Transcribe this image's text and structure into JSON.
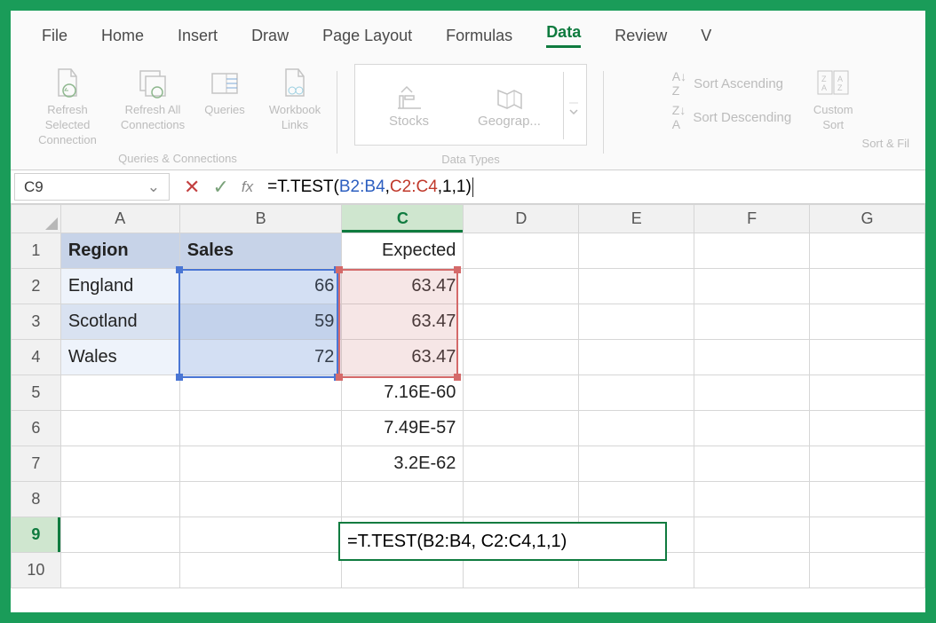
{
  "tabs": [
    "File",
    "Home",
    "Insert",
    "Draw",
    "Page Layout",
    "Formulas",
    "Data",
    "Review",
    "V"
  ],
  "activeTab": "Data",
  "ribbon": {
    "queries": {
      "refreshSelected": "Refresh Selected Connection",
      "refreshAll": "Refresh All Connections",
      "queries": "Queries",
      "workbookLinks": "Workbook Links",
      "groupLabel": "Queries & Connections"
    },
    "dataTypes": {
      "stocks": "Stocks",
      "geograp": "Geograp...",
      "groupLabel": "Data Types"
    },
    "sort": {
      "asc": "Sort Ascending",
      "desc": "Sort Descending",
      "custom": "Custom Sort",
      "groupLabel": "Sort & Fil"
    }
  },
  "nameBox": "C9",
  "formula": {
    "prefix": "=T.TEST(",
    "refB": "B2:B4",
    "comma1": ", ",
    "refC": "C2:C4",
    "suffix": ",1,1)"
  },
  "columns": [
    "A",
    "B",
    "C",
    "D",
    "E",
    "F",
    "G"
  ],
  "rows": [
    "1",
    "2",
    "3",
    "4",
    "5",
    "6",
    "7",
    "8",
    "9",
    "10"
  ],
  "cells": {
    "A1": "Region",
    "B1": "Sales",
    "C1": "Expected",
    "A2": "England",
    "B2": "66",
    "C2": "63.47",
    "A3": "Scotland",
    "B3": "59",
    "C3": "63.47",
    "A4": "Wales",
    "B4": "72",
    "C4": "63.47",
    "C5": "7.16E-60",
    "C6": "7.49E-57",
    "C7": "3.2E-62",
    "C9_display": "=T.TEST(B2:B4, C2:C4,1,1)"
  },
  "chart_data": {
    "type": "table",
    "title": "",
    "columns": [
      "Region",
      "Sales",
      "Expected"
    ],
    "rows": [
      {
        "Region": "England",
        "Sales": 66,
        "Expected": 63.47
      },
      {
        "Region": "Scotland",
        "Sales": 59,
        "Expected": 63.47
      },
      {
        "Region": "Wales",
        "Sales": 72,
        "Expected": 63.47
      }
    ],
    "extra_values_C": [
      7.16e-60,
      7.49e-57,
      3.2e-62
    ],
    "formula_in_C9": "=T.TEST(B2:B4, C2:C4,1,1)"
  }
}
